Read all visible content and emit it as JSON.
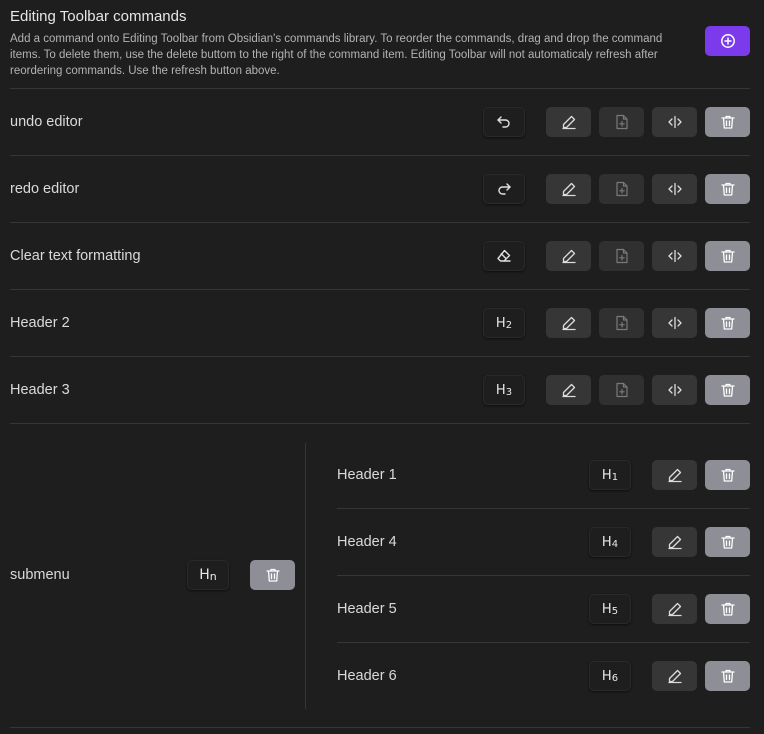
{
  "header": {
    "title": "Editing Toolbar commands",
    "description": "Add a command onto Editing Toolbar from Obsidian's commands library. To reorder the commands, drag and drop the command items. To delete them, use the delete buttom to the right of the command item. Editing Toolbar will not automaticaly refresh after reordering commands. Use the refresh button above.",
    "add_icon": "plus-circle-icon"
  },
  "colors": {
    "accent": "#7c3aed",
    "background": "#1e1e1e",
    "button": "#363636",
    "delete_button": "#8e8e96"
  },
  "commands": [
    {
      "label": "undo editor",
      "icon": "undo-icon"
    },
    {
      "label": "redo editor",
      "icon": "redo-icon"
    },
    {
      "label": "Clear text formatting",
      "icon": "eraser-icon"
    },
    {
      "label": "Header 2",
      "icon": "H2"
    },
    {
      "label": "Header 3",
      "icon": "H3"
    }
  ],
  "submenu": {
    "label": "submenu",
    "icon": "Hn",
    "items": [
      {
        "label": "Header 1",
        "icon": "H1"
      },
      {
        "label": "Header 4",
        "icon": "H4"
      },
      {
        "label": "Header 5",
        "icon": "H5"
      },
      {
        "label": "Header 6",
        "icon": "H6"
      }
    ]
  }
}
